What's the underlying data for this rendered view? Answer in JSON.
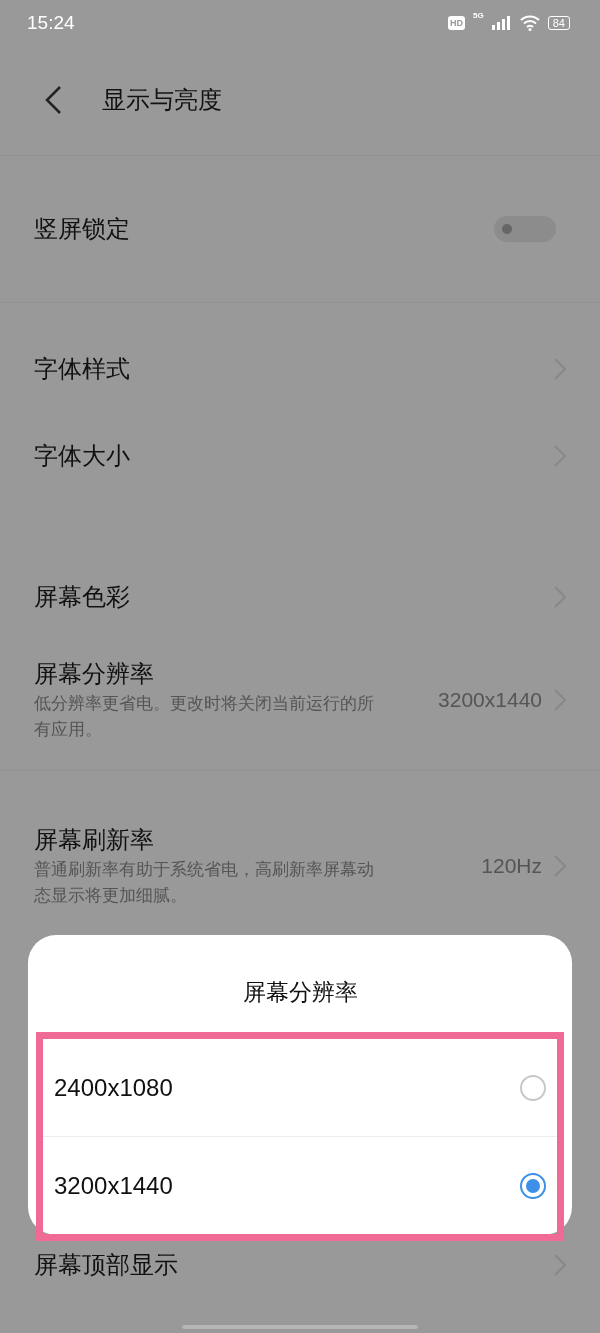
{
  "status_bar": {
    "time": "15:24",
    "hd": "HD",
    "network": "5G",
    "battery": "84"
  },
  "header": {
    "title": "显示与亮度"
  },
  "groups": [
    {
      "items": [
        {
          "kind": "toggle",
          "label": "竖屏锁定",
          "on": false
        }
      ]
    },
    {
      "items": [
        {
          "kind": "link",
          "label": "字体样式"
        },
        {
          "kind": "link",
          "label": "字体大小"
        }
      ]
    },
    {
      "items": [
        {
          "kind": "link",
          "label": "屏幕色彩"
        },
        {
          "kind": "link",
          "label": "屏幕分辨率",
          "description": "低分辨率更省电。更改时将关闭当前运行的所有应用。",
          "value": "3200x1440"
        }
      ]
    },
    {
      "items": [
        {
          "kind": "link",
          "label": "屏幕刷新率",
          "description": "普通刷新率有助于系统省电，高刷新率屏幕动态显示将更加细腻。",
          "value": "120Hz"
        }
      ]
    },
    {
      "items": [
        {
          "kind": "link",
          "label": "屏幕顶部显示"
        }
      ]
    }
  ],
  "dialog": {
    "title": "屏幕分辨率",
    "options": [
      {
        "label": "2400x1080",
        "selected": false
      },
      {
        "label": "3200x1440",
        "selected": true
      }
    ]
  }
}
